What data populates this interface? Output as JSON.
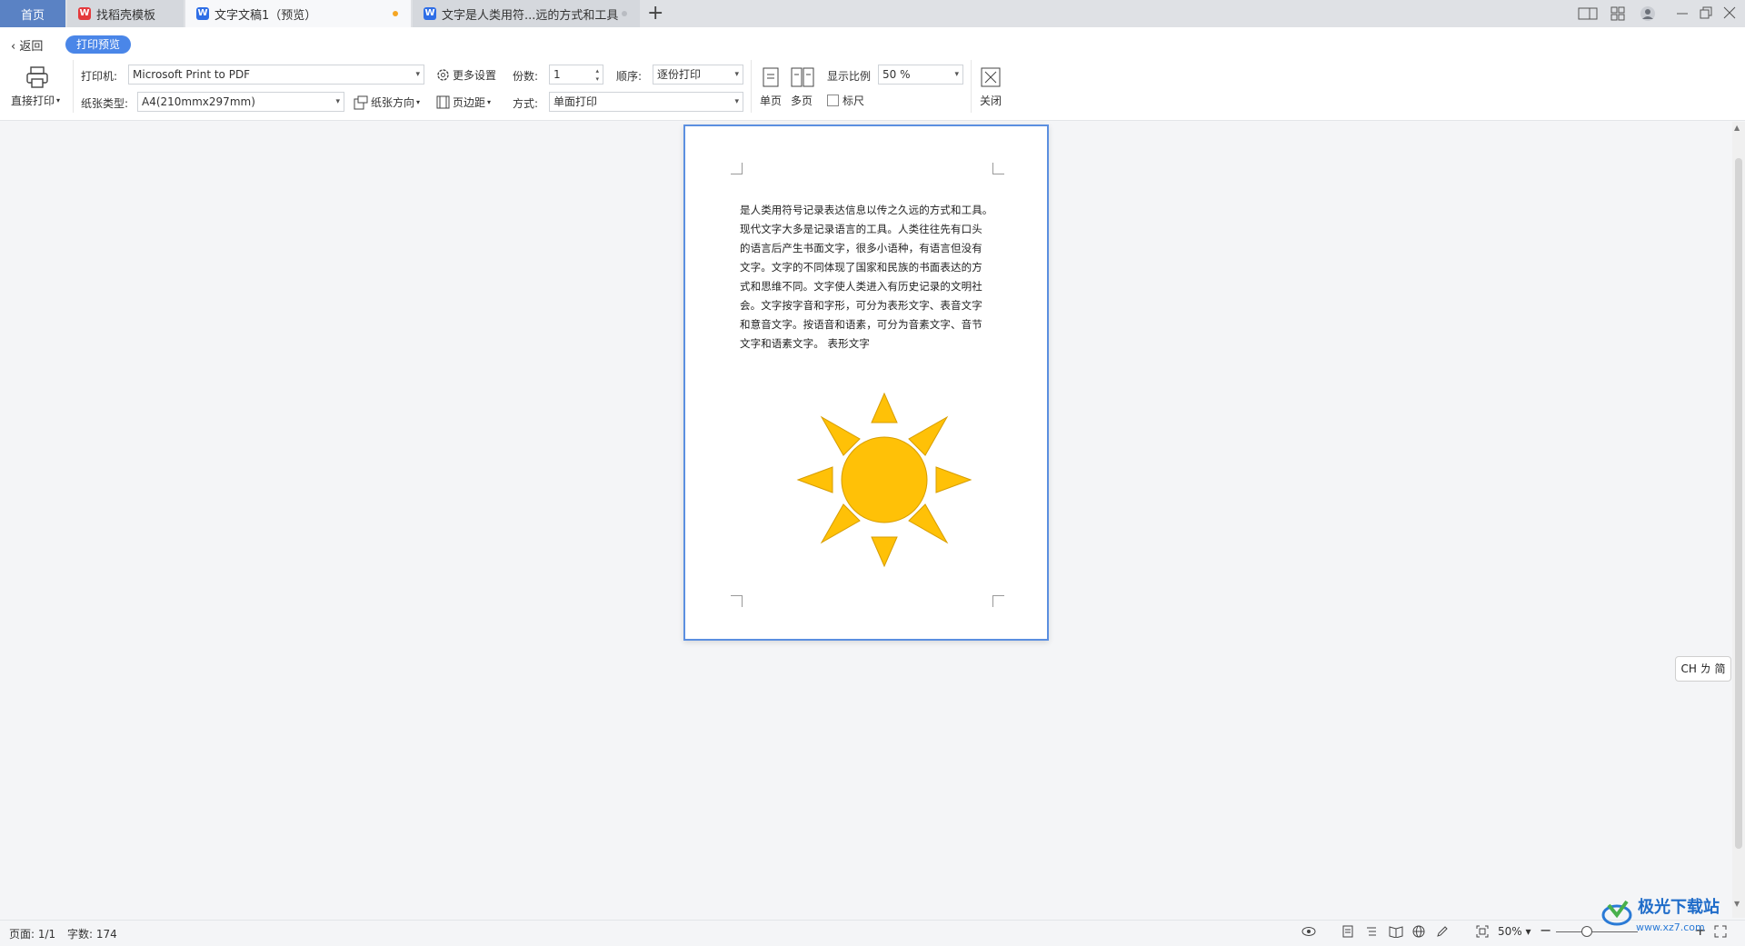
{
  "tabs": {
    "home": "首页",
    "templates": "找稻壳模板",
    "doc1": "文字文稿1（预览）",
    "doc2": "文字是人类用符...远的方式和工具",
    "add": "+"
  },
  "header": {
    "back": "返回",
    "mode_badge": "打印预览"
  },
  "toolbar": {
    "direct_print": "直接打印",
    "printer_label": "打印机:",
    "printer_value": "Microsoft Print to PDF",
    "more_settings": "更多设置",
    "copies_label": "份数:",
    "copies_value": "1",
    "order_label": "顺序:",
    "order_value": "逐份打印",
    "paper_label": "纸张类型:",
    "paper_value": "A4(210mmx297mm)",
    "orientation": "纸张方向",
    "margins": "页边距",
    "mode_label": "方式:",
    "mode_value": "单面打印",
    "single_page": "单页",
    "multi_page": "多页",
    "zoom_label": "显示比例",
    "zoom_value": "50 %",
    "ruler": "标尺",
    "close": "关闭"
  },
  "document": {
    "lines": [
      "是人类用符号记录表达信息以传之久远的方式和工具。",
      "现代文字大多是记录语言的工具。人类往往先有口头",
      "的语言后产生书面文字，很多小语种，有语言但没有",
      "文字。文字的不同体现了国家和民族的书面表达的方",
      "式和思维不同。文字使人类进入有历史记录的文明社",
      "会。文字按字音和字形，可分为表形文字、表音文字",
      "和意音文字。按语音和语素，可分为音素文字、音节",
      "文字和语素文字。  表形文字"
    ],
    "sun_color": "#ffc107"
  },
  "ime": "CH ㄌ 简",
  "status": {
    "page": "页面: 1/1",
    "words": "字数: 174",
    "zoom": "50%"
  },
  "watermark": {
    "brand": "极光下载站",
    "url": "www.xz7.com"
  }
}
